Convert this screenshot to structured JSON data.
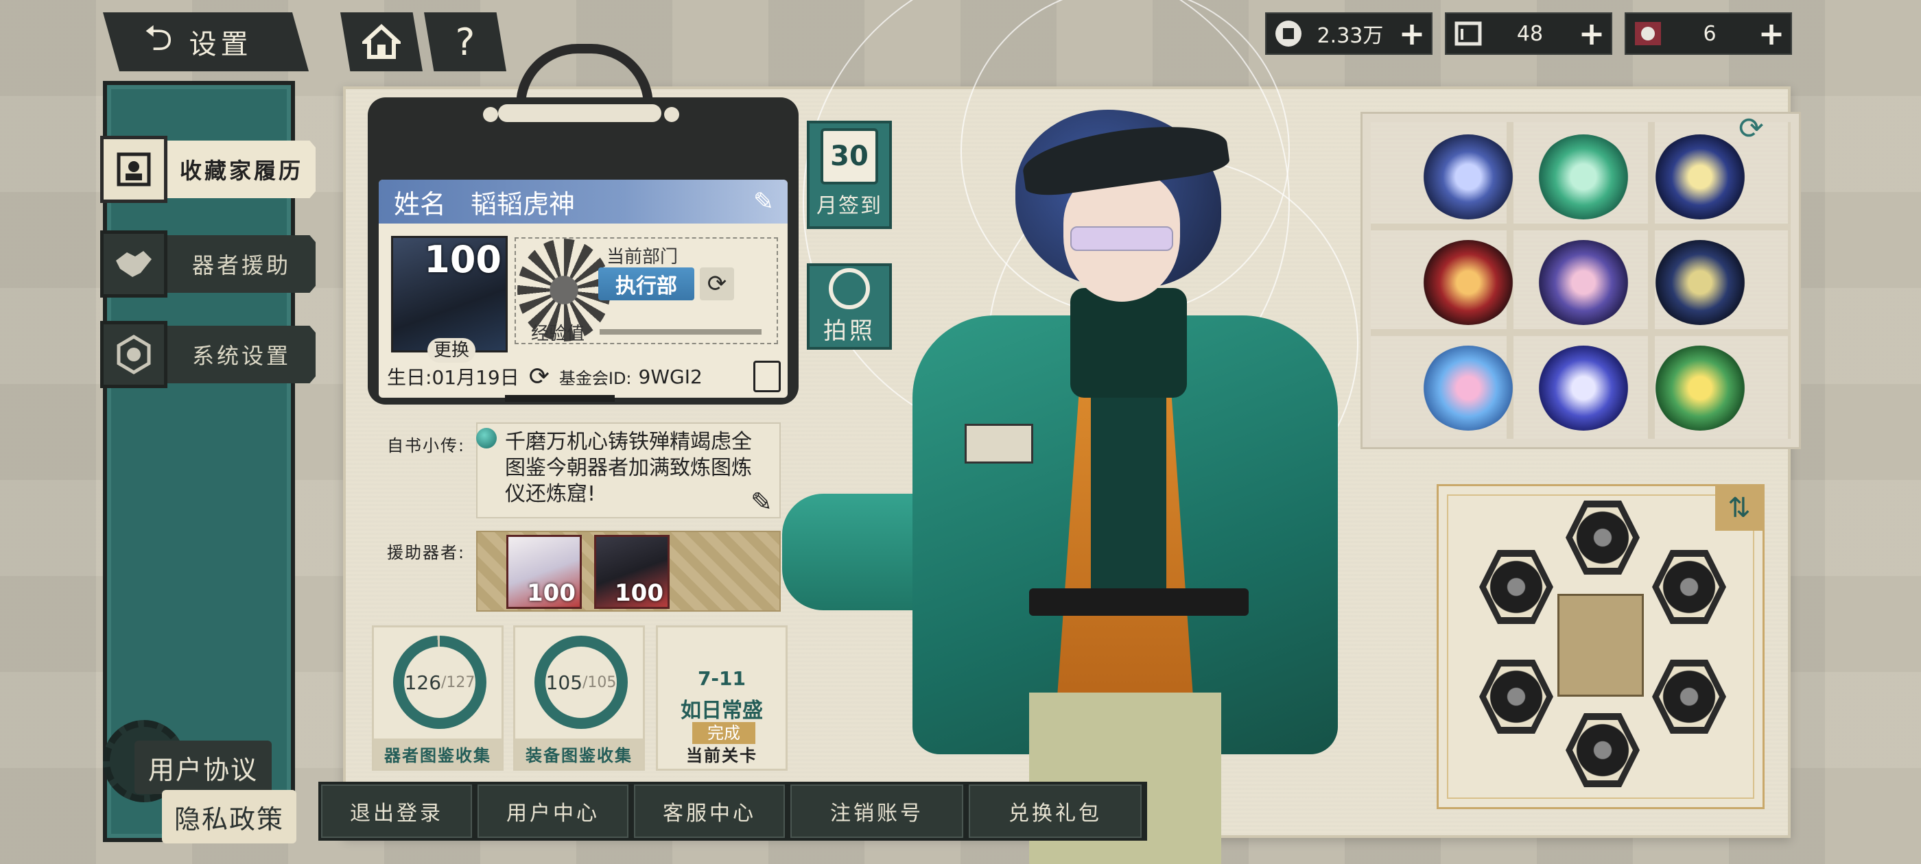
{
  "topbar": {
    "back_label": "设置",
    "home_icon": "home-icon",
    "help_label": "?"
  },
  "currencies": [
    {
      "icon": "coin-icon",
      "value": "2.33万",
      "plus": "+"
    },
    {
      "icon": "scroll-icon",
      "value": "48",
      "plus": "+"
    },
    {
      "icon": "ticket-icon",
      "value": "6",
      "plus": "+"
    }
  ],
  "sidebar": {
    "items": [
      {
        "label": "收藏家履历",
        "icon": "profile-card-icon",
        "active": true
      },
      {
        "label": "器者援助",
        "icon": "handshake-icon",
        "active": false
      },
      {
        "label": "系统设置",
        "icon": "gear-icon",
        "active": false
      }
    ],
    "user_agreement": "用户协议",
    "privacy_policy": "隐私政策"
  },
  "card": {
    "name_label": "姓名",
    "name": "韬韬虎神",
    "level": "100",
    "swap_label": "更换",
    "dept_label": "当前部门",
    "dept_value": "执行部",
    "exp_label": "经验值",
    "birthday_label": "生日:",
    "birthday": "01月19日",
    "fund_id_label": "基金会ID:",
    "fund_id": "9WGI2"
  },
  "side_buttons": {
    "calendar_day": "30",
    "calendar_label": "月签到",
    "photo_label": "拍照"
  },
  "bio": {
    "label": "自书小传:",
    "text": "千磨万机心铸铁殚精竭虑全图鉴今朝器者加满致炼图炼仪还炼窟!"
  },
  "assist": {
    "label": "援助器者:",
    "members": [
      {
        "level": "100"
      },
      {
        "level": "100"
      }
    ]
  },
  "stats": [
    {
      "current": "126",
      "total": "/127",
      "label": "器者图鉴收集",
      "progress": 0.992
    },
    {
      "current": "105",
      "total": "/105",
      "label": "装备图鉴收集",
      "progress": 1.0
    }
  ],
  "stage": {
    "number": "7-11",
    "name": "如日常盛",
    "status": "完成",
    "label": "当前关卡"
  },
  "bottom_buttons": [
    "退出登录",
    "用户中心",
    "客服中心",
    "注销账号",
    "兑换礼包"
  ],
  "colors": {
    "teal": "#2f7570",
    "dark": "#2b2f2e",
    "paper": "#e8e2d1",
    "name_bar": "#5d7db2",
    "gold": "#c9a86a"
  }
}
